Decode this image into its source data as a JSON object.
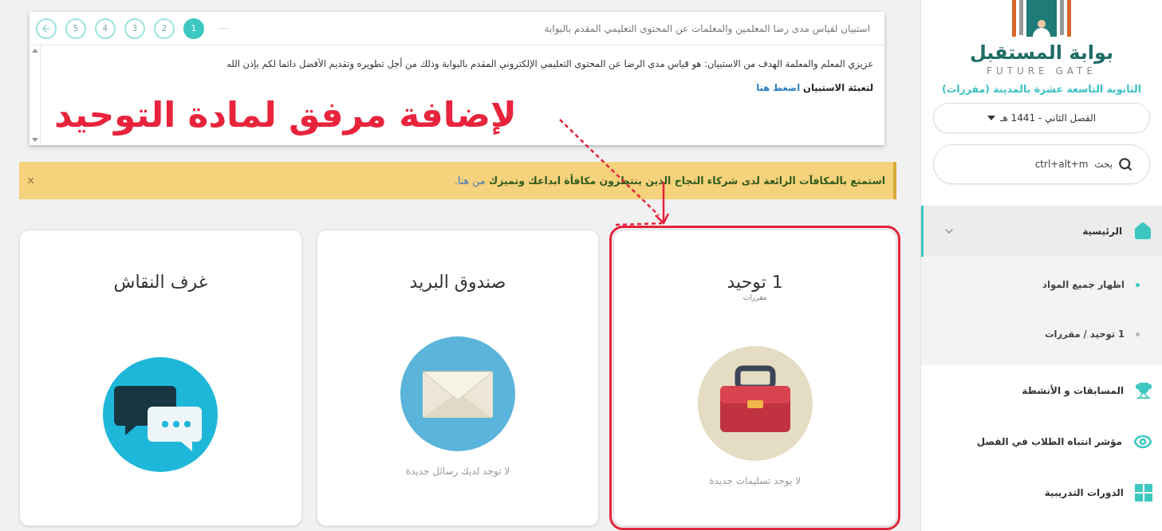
{
  "survey": {
    "title": "استبيان لقياس مدى رضا المعلمين والمعلمات عن المحتوى التعليمي المقدم بالبوابة",
    "steps": [
      {
        "label": "1",
        "selected": true
      },
      {
        "label": "2",
        "selected": false
      },
      {
        "label": "3",
        "selected": false
      },
      {
        "label": "4",
        "selected": false
      },
      {
        "label": "5",
        "selected": false
      }
    ],
    "message": "عزيزي المعلم والمعلمة الهدف من الاستبيان: هو قياس مدى الرضا عن المحتوى التعليمي الإلكتروني المقدم بالبوابة وذلك من أجل تطويره وتقديم الأفضل دائما لكم بإذن الله",
    "cta_label": "لتعبئة الاستبيان",
    "cta_link": "اضغط هنا"
  },
  "annotation": {
    "text": "لإضافة مرفق لمادة التوحيد"
  },
  "banner": {
    "text": "استمتع بالمكافآت الرائعة لدى شركاء النجاح الذين ينتظرون مكافأة ابداعك وتميزك",
    "link": "من هنا.",
    "close": "×"
  },
  "cards": [
    {
      "kind": "course",
      "title": "1 توحيد",
      "subtitle": "مقررات",
      "footer": "لا يوجد تسليمات جديدة",
      "highlighted": true
    },
    {
      "kind": "mail",
      "title": "صندوق البريد",
      "footer": "لا توجد لديك رسائل جديدة",
      "highlighted": false
    },
    {
      "kind": "chat",
      "title": "غرف النقاش",
      "highlighted": false
    }
  ],
  "sidebar": {
    "brand": "بوابة المستقبل",
    "brand_latin": "FUTURE GATE",
    "school": "الثانوية التاسعة عشرة بالمدينة (مقررات)",
    "term": "الفصل الثاني - 1441 هـ",
    "search_placeholder": "بحث  ctrl+alt+m",
    "nav": [
      {
        "label": "الرئيسية",
        "selected": true,
        "expanded": true,
        "children": [
          {
            "label": "اظهار جميع المواد",
            "selected": true
          },
          {
            "label": "1 توحيد / مقررات",
            "selected": false
          }
        ]
      },
      {
        "label": "المسابقات و الأنشطة",
        "selected": false
      },
      {
        "label": "مؤشر انتباه الطلاب في الفصل",
        "selected": false
      },
      {
        "label": "الدورات التدريبية",
        "selected": false
      }
    ]
  }
}
